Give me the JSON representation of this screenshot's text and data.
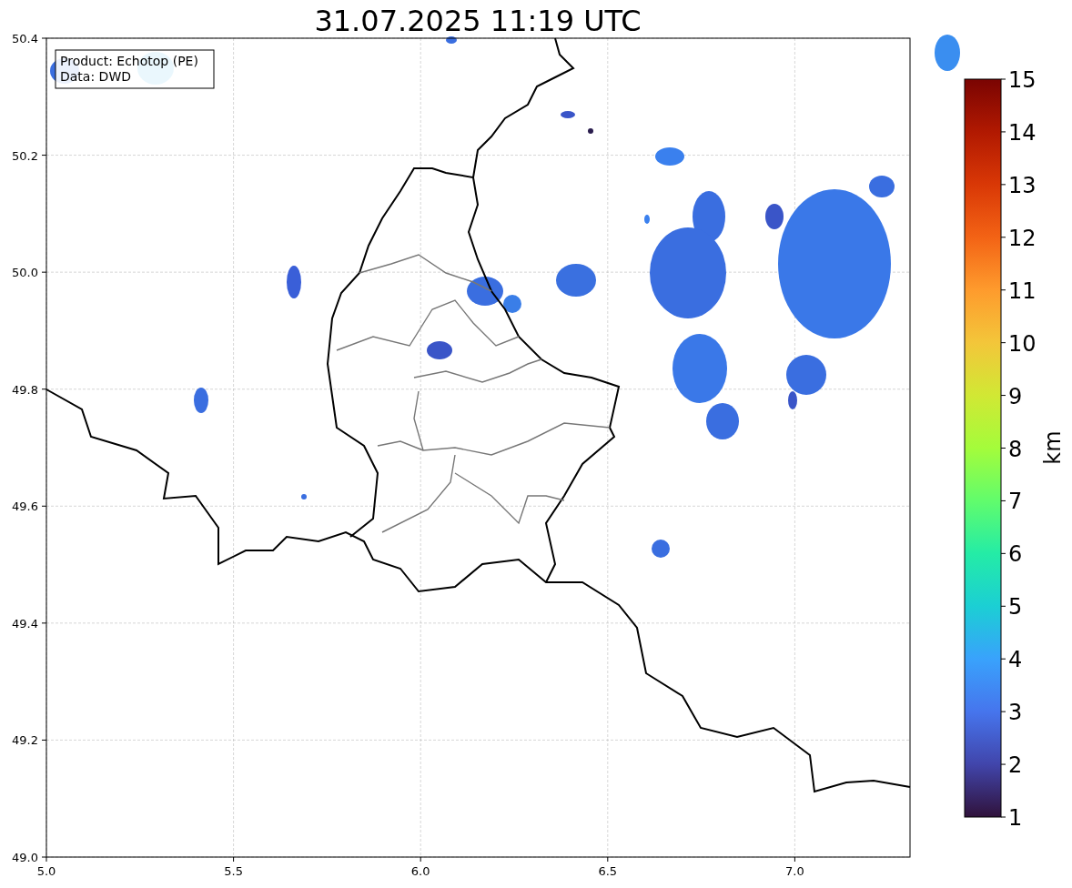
{
  "title": "31.07.2025 11:19 UTC",
  "legend": [
    "Product: Echotop (PE)",
    "Data: DWD"
  ],
  "map": {
    "x_ticks": [
      "5.0",
      "5.5",
      "6.0",
      "6.5",
      "7.0"
    ],
    "y_ticks": [
      "50.4",
      "50.2",
      "50.0",
      "49.8",
      "49.6",
      "49.4",
      "49.2",
      "49.0"
    ]
  },
  "colorbar": {
    "label": "km",
    "ticks": [
      "15",
      "14",
      "13",
      "12",
      "11",
      "10",
      "9",
      "8",
      "7",
      "6",
      "5",
      "4",
      "3",
      "2",
      "1"
    ]
  }
}
